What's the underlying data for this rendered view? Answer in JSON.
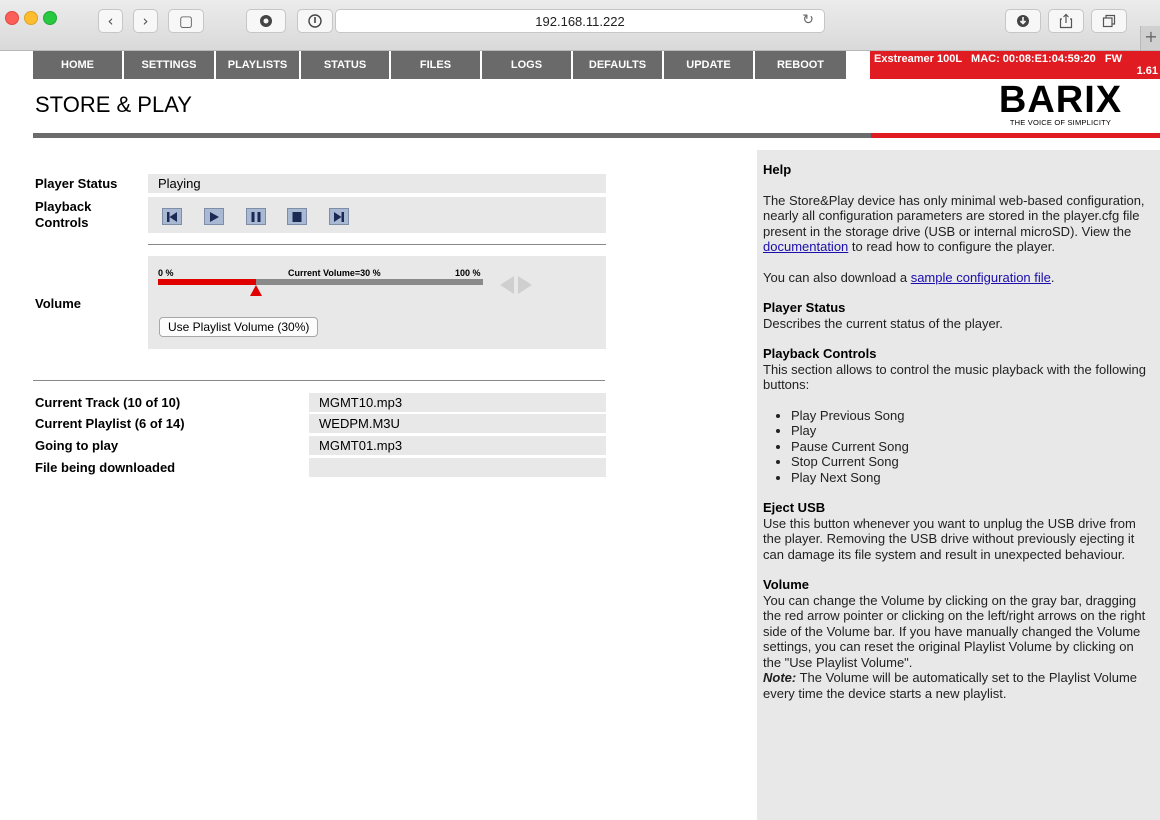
{
  "browser": {
    "url": "192.168.11.222",
    "back_glyph": "‹",
    "forward_glyph": "›",
    "sidebar_glyph": "▢",
    "reload_glyph": "↻",
    "new_tab_glyph": "+"
  },
  "nav": {
    "items": [
      "HOME",
      "SETTINGS",
      "PLAYLISTS",
      "STATUS",
      "FILES",
      "LOGS",
      "DEFAULTS",
      "UPDATE",
      "REBOOT"
    ],
    "device_info_line1": "Exstreamer 100L   MAC: 00:08:E1:04:59:20   FW",
    "device_info_line2": "1.61"
  },
  "page": {
    "title": "STORE & PLAY",
    "logo_word": "BARIX",
    "logo_tagline": "THE VOICE OF SIMPLICITY"
  },
  "player": {
    "status_label": "Player Status",
    "status_value": "Playing",
    "controls_label": "Playback Controls",
    "controls": [
      "previous",
      "play",
      "pause",
      "stop",
      "next"
    ],
    "volume_label": "Volume",
    "volume_min_label": "0 %",
    "volume_current_label": "Current Volume=30 %",
    "volume_max_label": "100 %",
    "volume_percent": 30,
    "use_playlist_volume_label": "Use Playlist Volume (30%)"
  },
  "tracks": {
    "current_track_label": "Current Track (10 of 10)",
    "current_track_value": "MGMT10.mp3",
    "current_playlist_label": "Current Playlist (6 of 14)",
    "current_playlist_value": "WEDPM.M3U",
    "going_to_play_label": "Going to play",
    "going_to_play_value": "MGMT01.mp3",
    "downloading_label": "File being downloaded",
    "downloading_value": ""
  },
  "help": {
    "title": "Help",
    "intro_1": "The Store&Play device has only minimal web-based configuration, nearly all configuration parameters are stored in the player.cfg file present in the storage drive (USB or internal microSD). View the ",
    "intro_link": "documentation",
    "intro_2": " to read how to configure the player.",
    "download_1": "You can also download a ",
    "download_link": "sample configuration file",
    "download_2": ".",
    "status_title": "Player Status",
    "status_text": "Describes the current status of the player.",
    "controls_title": "Playback Controls",
    "controls_text": "This section allows to control the music playback with the following buttons:",
    "controls_list": [
      "Play Previous Song",
      "Play",
      "Pause Current Song",
      "Stop Current Song",
      "Play Next Song"
    ],
    "eject_title": "Eject USB",
    "eject_text": "Use this button whenever you want to unplug the USB drive from the player. Removing the USB drive without previously ejecting it can damage its file system and result in unexpected behaviour.",
    "volume_title": "Volume",
    "volume_text": "You can change the Volume by clicking on the gray bar, dragging the red arrow pointer or clicking on the left/right arrows on the right side of the Volume bar. If you have manually changed the Volume settings, you can reset the original Playlist Volume by clicking on the \"Use Playlist Volume\".",
    "note_label": "Note:",
    "note_text": " The Volume will be automatically set to the Playlist Volume every time the device starts a new playlist."
  }
}
